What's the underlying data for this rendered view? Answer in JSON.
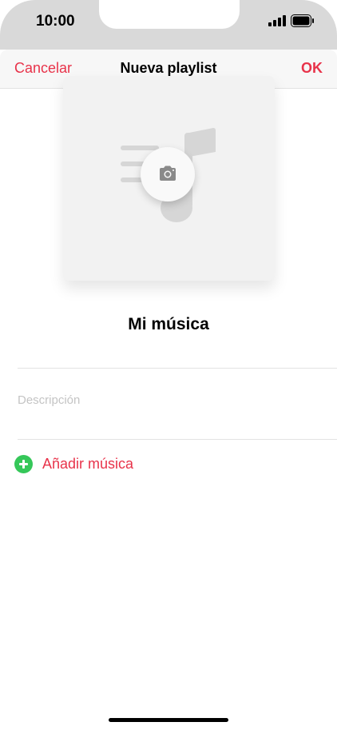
{
  "status_bar": {
    "time": "10:00",
    "icons": [
      "signal-icon",
      "battery-icon"
    ]
  },
  "navbar": {
    "cancel_label": "Cancelar",
    "title": "Nueva playlist",
    "ok_label": "OK"
  },
  "artwork": {
    "icons": [
      "music-note-icon",
      "camera-icon"
    ]
  },
  "playlist": {
    "name": "Mi música",
    "description_placeholder": "Descripción"
  },
  "actions": {
    "add_music_label": "Añadir música"
  },
  "colors": {
    "accent": "#e8334a",
    "add_icon": "#35c759",
    "placeholder": "#c4c4c4"
  }
}
